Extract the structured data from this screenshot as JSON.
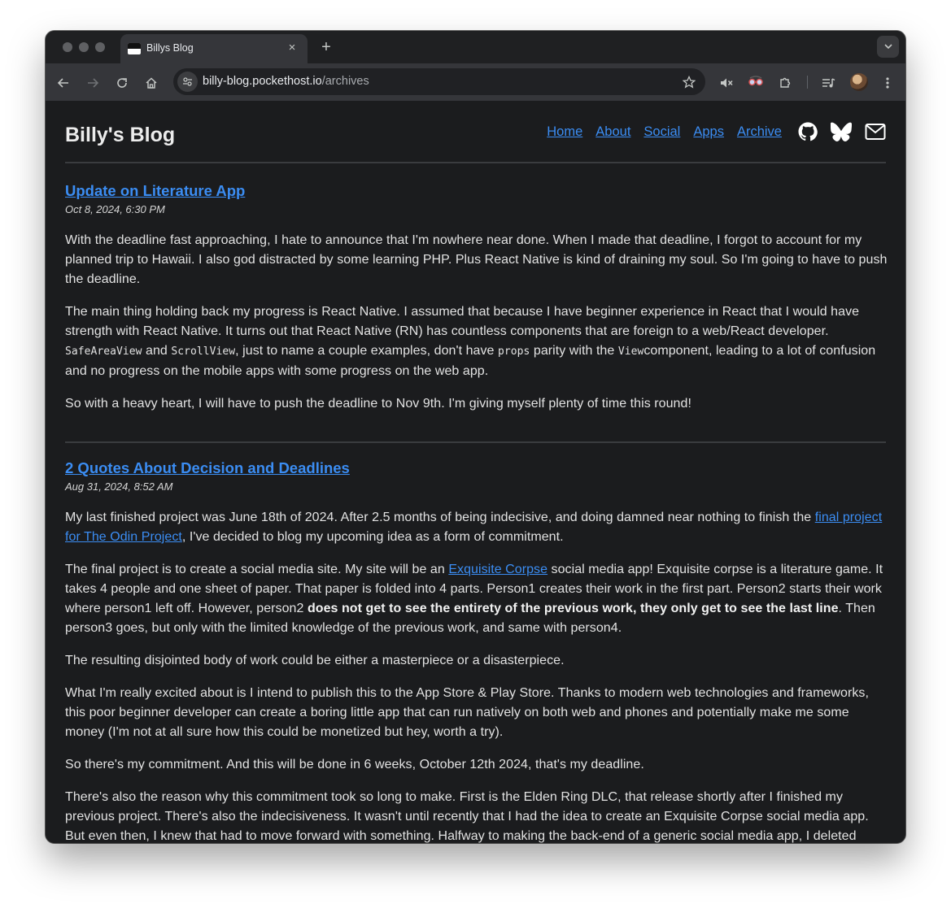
{
  "browser": {
    "tab_title": "Billys Blog",
    "tab_close": "×",
    "new_tab": "+",
    "tab_search": "⌄",
    "url_host": "billy-blog.pockethost.io",
    "url_path": "/archives",
    "back": "←",
    "forward": "→",
    "reload": "↻",
    "home": "⌂",
    "star": "☆",
    "mute": "🔇",
    "extensions": "⧉",
    "reading_list": "≡",
    "menu": "⋮",
    "site_info": "⚙"
  },
  "site": {
    "title": "Billy's Blog",
    "nav": [
      "Home",
      "About",
      "Social",
      "Apps",
      "Archive"
    ],
    "icons": [
      "github-icon",
      "bluesky-icon",
      "mail-icon"
    ]
  },
  "posts": [
    {
      "title": "Update on Literature App",
      "date": "Oct 8, 2024, 6:30 PM",
      "p1": [
        "With the deadline fast approaching, I hate to announce that I'm nowhere near done. When I made that deadline, I forgot to account for my",
        "planned trip to Hawaii. I also god distracted by some learning PHP. Plus React Native is kind of draining my soul. So I'm going to have to push",
        "the deadline."
      ],
      "p2_line1": "The main thing holding back my progress is React Native. I assumed that because I have beginner experience in React that I would have",
      "p2_line2": "strength with React Native. It turns out that React Native (RN) has countless components that are foreign to a web/React developer.",
      "p2_code1": "SafeAreaView",
      "p2_and": " and ",
      "p2_code2": "ScrollView",
      "p2_mid": ", just to name a couple examples, don't have ",
      "p2_code3": "props",
      "p2_parity": " parity with the ",
      "p2_code4": "View",
      "p2_end": "component, leading to a lot of confusion",
      "p2_line4": "and no progress on the mobile apps with some progress on the web app.",
      "p3": "So with a heavy heart, I will have to push the deadline to Nov 9th. I'm giving myself plenty of time this round!"
    },
    {
      "title": "2 Quotes About Decision and Deadlines",
      "date": "Aug 31, 2024, 8:52 AM",
      "p1_a": "My last finished project was June 18th of 2024. After 2.5 months of being indecisive, and doing damned near nothing to finish the ",
      "p1_link_a": "final project",
      "p1_link_b": "for The Odin Project",
      "p1_b": ", I've decided to blog my upcoming idea as a form of commitment.",
      "p2_a": "The final project is to create a social media site. My site will be an ",
      "p2_link": "Exquisite Corpse",
      "p2_b": " social media app! Exquisite corpse is a literature game. It",
      "p2_line2": "takes 4 people and one sheet of paper. That paper is folded into 4 parts. Person1 creates their work in the first part. Person2 starts their work",
      "p2_c": "where person1 left off. However, person2 ",
      "p2_bold": "does not get to see the entirety of the previous work, they only get to see the last line",
      "p2_d": ". Then",
      "p2_line4": "person3 goes, but only with the limited knowledge of the previous work, and same with person4.",
      "p3": "The resulting disjointed body of work could be either a masterpiece or a disasterpiece.",
      "p4": [
        "What I'm really excited about is I intend to publish this to the App Store & Play Store. Thanks to modern web technologies and frameworks,",
        "this poor beginner developer can create a boring little app that can run natively on both web and phones and potentially make me some",
        "money (I'm not at all sure how this could be monetized but hey, worth a try)."
      ],
      "p5": "So there's my commitment. And this will be done in 6 weeks, October 12th 2024, that's my deadline.",
      "p6": [
        "There's also the reason why this commitment took so long to make. First is the Elden Ring DLC, that release shortly after I finished my",
        "previous project. There's also the indecisiveness. It wasn't until recently that I had the idea to create an Exquisite Corpse social media app.",
        "But even then, I knew that had to move forward with something. Halfway to making the back-end of a generic social media app, I deleted"
      ]
    }
  ]
}
